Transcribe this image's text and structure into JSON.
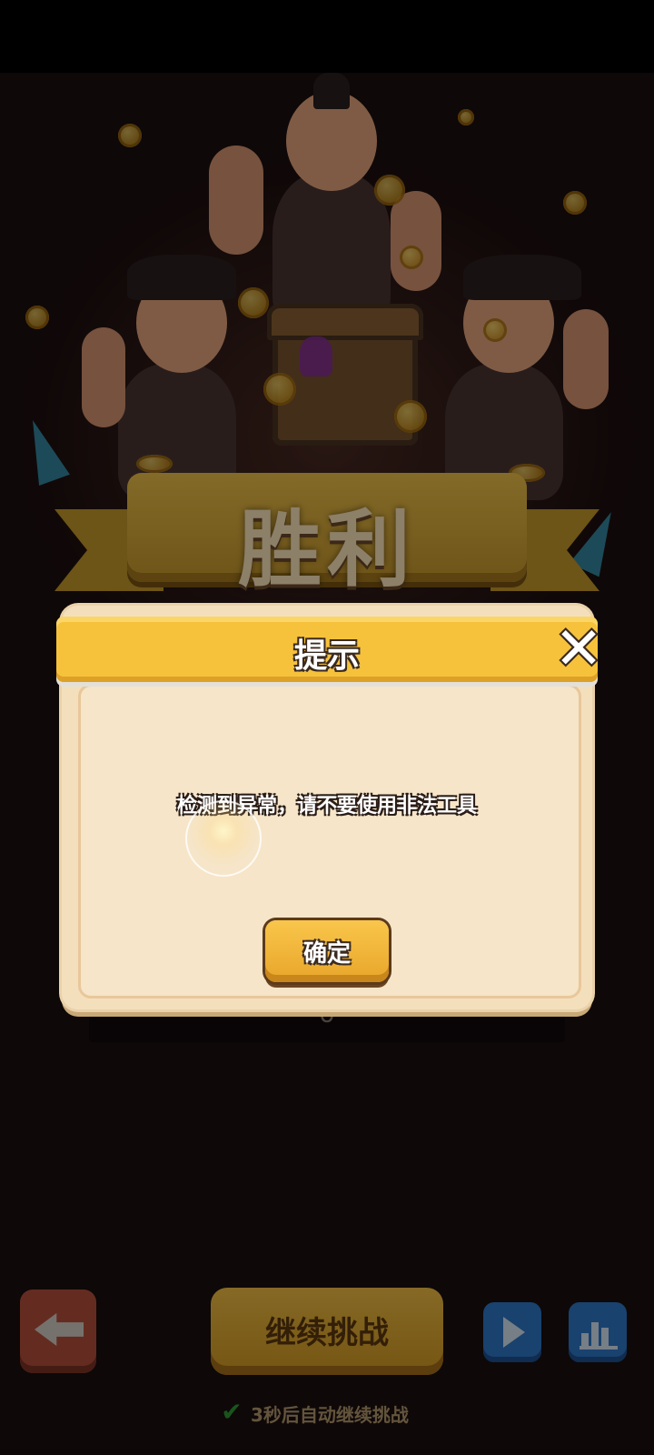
{
  "background": {
    "victory_banner": "胜利"
  },
  "score": {
    "value": "0"
  },
  "bottom_bar": {
    "continue_label": "继续挑战",
    "auto_continue_label": "3秒后自动继续挑战",
    "auto_continue_checked": true,
    "back_icon": "arrow-left-icon",
    "play_icon": "play-icon",
    "stats_icon": "bar-chart-icon"
  },
  "dialog": {
    "title": "提示",
    "message": "检测到异常，请不要使用非法工具",
    "confirm_label": "确定",
    "close_icon": "close-icon"
  },
  "colors": {
    "dialog_header": "#f6c23c",
    "dialog_body": "#f4dfbd",
    "confirm_button": "#f9c64b",
    "continue_button": "#e3ab35",
    "back_button": "#b6503c",
    "blue_buttons": "#2f78c9"
  }
}
